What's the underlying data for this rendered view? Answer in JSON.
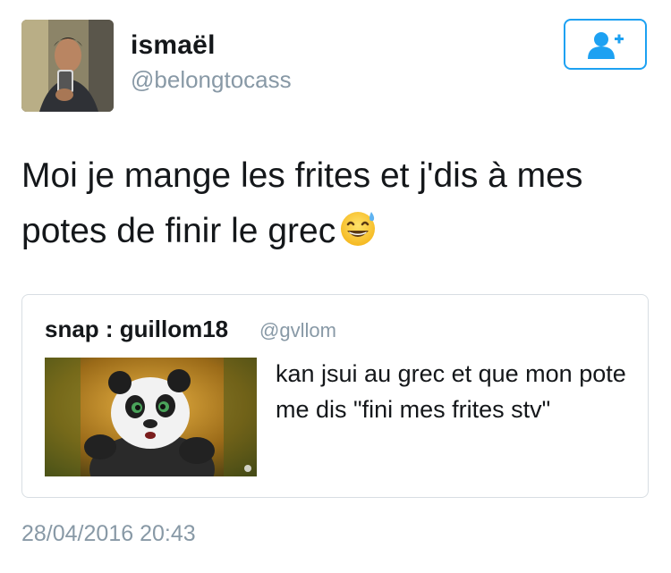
{
  "author": {
    "display_name": "ismaël",
    "handle": "@belongtocass",
    "avatar_icon": "profile-photo"
  },
  "follow_button": {
    "icon": "follow-user-plus-icon",
    "color": "#1da1f2"
  },
  "tweet": {
    "text": "Moi je mange les frites et j'dis à mes potes de finir le grec",
    "emoji": "grinning-face-with-sweat-emoji"
  },
  "quoted_tweet": {
    "display_name": "snap : guillom18",
    "handle": "@gvllom",
    "text": "kan jsui au grec et que mon pote me dis \"fini mes frites stv\"",
    "media": "panda-gif-thumbnail"
  },
  "timestamp": "28/04/2016 20:43",
  "colors": {
    "text": "#14171a",
    "secondary": "#8899a6",
    "border": "#d8dee3",
    "accent": "#1da1f2"
  }
}
